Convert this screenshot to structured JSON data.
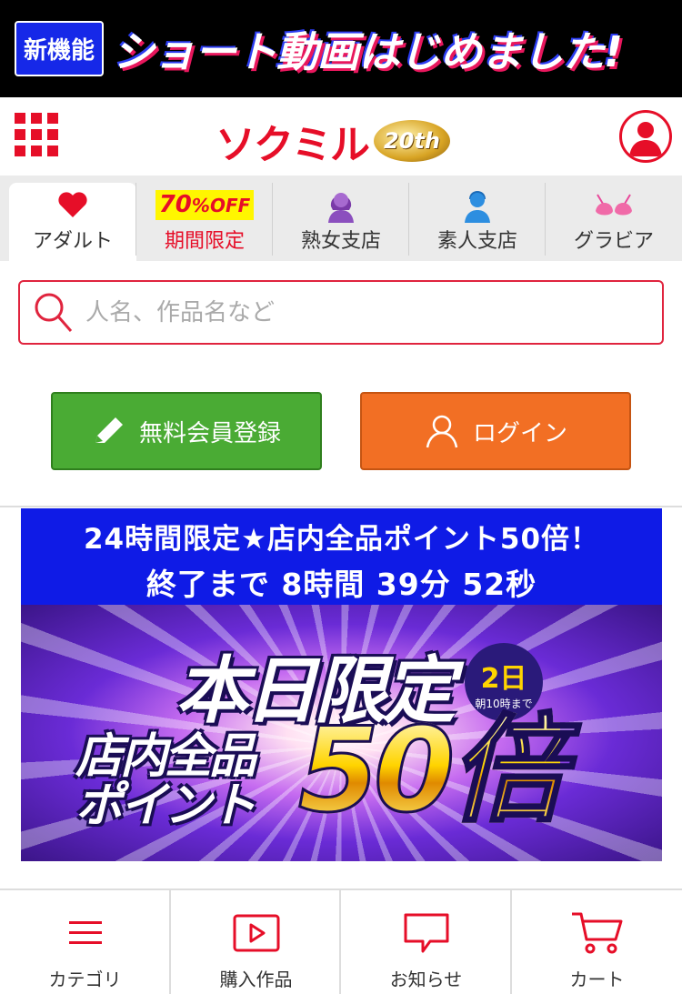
{
  "promo": {
    "badge": "新機能",
    "text": "ショート動画はじめました!"
  },
  "header": {
    "logo_text": "ソクミル",
    "logo_badge": "20th"
  },
  "tabs": [
    {
      "label": "アダルト",
      "icon": "heart-icon"
    },
    {
      "label": "期間限定",
      "badge": "70",
      "badge_unit": "%OFF"
    },
    {
      "label": "熟女支店",
      "icon": "woman-icon"
    },
    {
      "label": "素人支店",
      "icon": "person-icon"
    },
    {
      "label": "グラビア",
      "icon": "bra-icon"
    }
  ],
  "search": {
    "placeholder": "人名、作品名など"
  },
  "buttons": {
    "register": "無料会員登録",
    "login": "ログイン"
  },
  "campaign": {
    "line1": "24時間限定★店内全品ポイント50倍！",
    "line2": "終了まで 8時間 39分 52秒",
    "title": "本日限定",
    "days": "2日",
    "days_sub": "朝10時まで",
    "sub1": "店内全品",
    "sub2": "ポイント",
    "big": "50倍"
  },
  "bottom_nav": [
    {
      "label": "カテゴリ",
      "icon": "hamburger-icon"
    },
    {
      "label": "購入作品",
      "icon": "play-icon"
    },
    {
      "label": "お知らせ",
      "icon": "speech-bubble-icon"
    },
    {
      "label": "カート",
      "icon": "cart-icon"
    }
  ],
  "colors": {
    "brand_red": "#e60e28",
    "green": "#4aab34",
    "orange": "#f26f24",
    "campaign_blue": "#0f1be6"
  }
}
